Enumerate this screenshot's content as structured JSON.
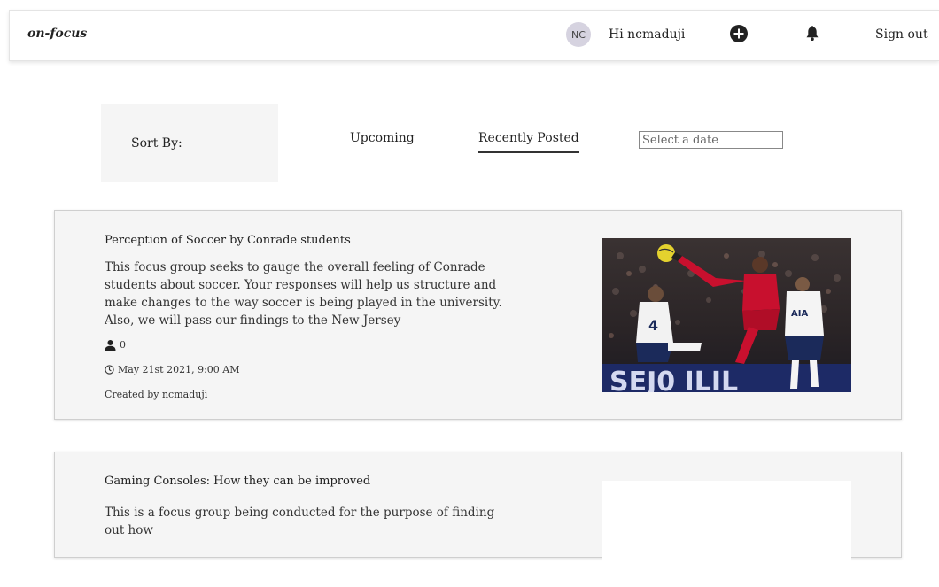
{
  "header": {
    "brand": "on-focus",
    "avatar_initials": "NC",
    "greeting": "Hi ncmaduji",
    "add_icon": "plus-circle-icon",
    "bell_icon": "bell-icon",
    "signout_label": "Sign out"
  },
  "sort": {
    "label": "Sort By:",
    "tabs": [
      "Upcoming",
      "Recently Posted"
    ],
    "active_tab": "Recently Posted",
    "date_placeholder": "Select a date"
  },
  "posts": [
    {
      "title": "Perception of Soccer by Conrade students",
      "description": "This focus group seeks to gauge the overall feeling of Conrade students about soccer. Your responses will help us structure and make changes to the way soccer is being played in the university. Also, we will pass our findings to the New Jersey",
      "attendees": "0",
      "datetime": "May 21st 2021, 9:00 AM",
      "creator": "Created by ncmaduji"
    },
    {
      "title": "Gaming Consoles: How they can be improved",
      "description": "This is a focus group being conducted for the purpose of finding out how"
    }
  ],
  "colors": {
    "card_bg": "#f5f5f5",
    "avatar_bg": "#d6d3e0"
  }
}
